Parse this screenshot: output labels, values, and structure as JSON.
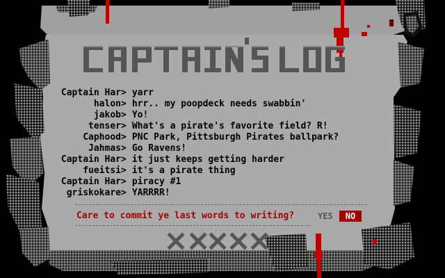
{
  "title": "CAPTAIN'S LOG",
  "log": [
    {
      "nick": "Captain Har",
      "text": "yarr"
    },
    {
      "nick": "halon",
      "text": "hrr.. my poopdeck needs swabbin'"
    },
    {
      "nick": "jakob",
      "text": "Yo!"
    },
    {
      "nick": "tenser",
      "text": "What's a pirate's favorite field? R!"
    },
    {
      "nick": "Caphood",
      "text": "PNC Park, Pittsburgh Pirates ballpark?"
    },
    {
      "nick": "Jahmas",
      "text": "Go Ravens!"
    },
    {
      "nick": "Captain Har",
      "text": "it just keeps getting harder"
    },
    {
      "nick": "fueitsi",
      "text": "it's a pirate thing"
    },
    {
      "nick": "Captain Har",
      "text": "piracy #1"
    },
    {
      "nick": "griskokare",
      "text": "YARRRR!"
    }
  ],
  "prompt": "Care to commit ye last words to writing?",
  "yes_label": "YES",
  "no_label": "NO",
  "selected_option": "NO",
  "colors": {
    "background": "#000000",
    "parchment": "#aaaaaa",
    "parchment_dark": "#555555",
    "text": "#000000",
    "prompt": "#a80000",
    "highlight": "#a80000",
    "blood": "#c00000"
  }
}
